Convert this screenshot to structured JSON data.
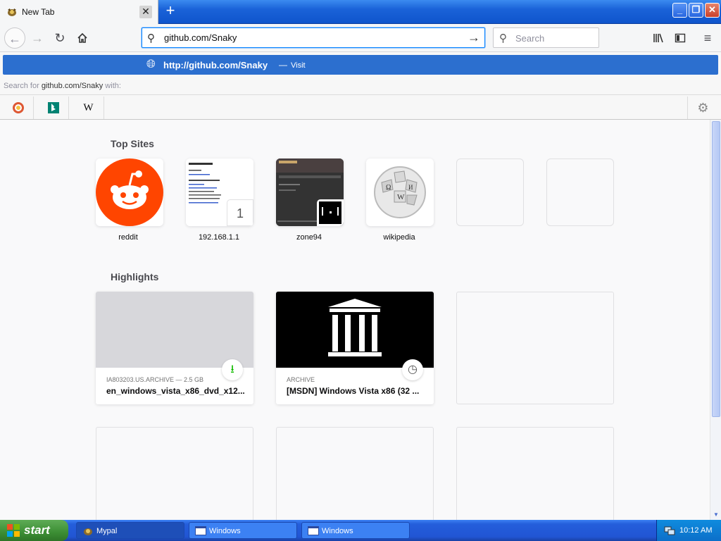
{
  "browser": {
    "tab": {
      "title": "New Tab",
      "close": "✕"
    },
    "newtab": "+",
    "window_buttons": {
      "minimize": "_",
      "restore": "❐",
      "close": "✕"
    },
    "url": "github.com/Snaky",
    "search_placeholder": "Search"
  },
  "popup": {
    "visit_url": "http://github.com/Snaky",
    "visit_sep": "—",
    "visit_label": "Visit",
    "search_with_prefix": "Search for ",
    "search_with_query": "github.com/Snaky",
    "search_with_suffix": " with:",
    "engines": [
      "DuckDuckGo",
      "Bing",
      "Wikipedia"
    ]
  },
  "newtab": {
    "top_sites_title": "Top Sites",
    "top_sites": [
      {
        "label": "reddit",
        "icon": "reddit-icon"
      },
      {
        "label": "192.168.1.1",
        "icon": "page-thumbnail",
        "badge": "1"
      },
      {
        "label": "zone94",
        "icon": "zone94-thumbnail"
      },
      {
        "label": "wikipedia",
        "icon": "wikipedia-icon"
      }
    ],
    "highlights_title": "Highlights",
    "highlights": [
      {
        "context": "IA803203.US.ARCHIVE — 2.5 GB",
        "title": "en_windows_vista_x86_dvd_x12...",
        "badge_icon": "download-icon"
      },
      {
        "context": "ARCHIVE",
        "title": "[MSDN] Windows Vista x86 (32 ...",
        "badge_icon": "clock-icon"
      }
    ]
  },
  "taskbar": {
    "start": "start",
    "items": [
      "Mypal",
      "Windows",
      "Windows"
    ],
    "clock": "10:12 AM"
  },
  "colors": {
    "accent": "#0a84ff",
    "reddit": "#ff4500",
    "xp_blue": "#245edb",
    "xp_green": "#3c8e34"
  }
}
